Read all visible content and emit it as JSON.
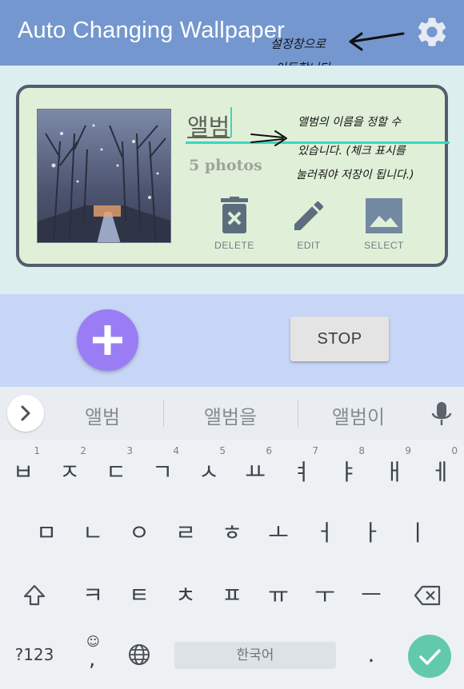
{
  "appbar": {
    "title": "Auto Changing Wallpaper",
    "settings_icon": "gear-icon"
  },
  "album": {
    "name": "앨범",
    "photo_count": "5 photos",
    "actions": [
      {
        "label": "DELETE",
        "icon": "delete-icon"
      },
      {
        "label": "EDIT",
        "icon": "pencil-icon"
      },
      {
        "label": "SELECT",
        "icon": "image-icon"
      }
    ]
  },
  "annotations": {
    "settings_note_line1": "설정창으로",
    "settings_note_line2": "이동합니다.",
    "album_note_line1": "앨범의 이름을 정할 수",
    "album_note_line2": "있습니다. (체크 표시를",
    "album_note_line3": "눌러줘야 저장이 됩니다.)"
  },
  "controls": {
    "add_icon": "plus-icon",
    "stop_label": "STOP"
  },
  "keyboard": {
    "suggestions": [
      "앨범",
      "앨범을",
      "앨범이"
    ],
    "row1": [
      {
        "key": "ㅂ",
        "hint": "1"
      },
      {
        "key": "ㅈ",
        "hint": "2"
      },
      {
        "key": "ㄷ",
        "hint": "3"
      },
      {
        "key": "ㄱ",
        "hint": "4"
      },
      {
        "key": "ㅅ",
        "hint": "5"
      },
      {
        "key": "ㅛ",
        "hint": "6"
      },
      {
        "key": "ㅕ",
        "hint": "7"
      },
      {
        "key": "ㅑ",
        "hint": "8"
      },
      {
        "key": "ㅐ",
        "hint": "9"
      },
      {
        "key": "ㅔ",
        "hint": "0"
      }
    ],
    "row2": [
      "ㅁ",
      "ㄴ",
      "ㅇ",
      "ㄹ",
      "ㅎ",
      "ㅗ",
      "ㅓ",
      "ㅏ",
      "ㅣ"
    ],
    "row3": [
      "ㅋ",
      "ㅌ",
      "ㅊ",
      "ㅍ",
      "ㅠ",
      "ㅜ",
      "ㅡ"
    ],
    "symbols_label": "?123",
    "comma": ",",
    "space_label": "한국어",
    "period": "."
  }
}
